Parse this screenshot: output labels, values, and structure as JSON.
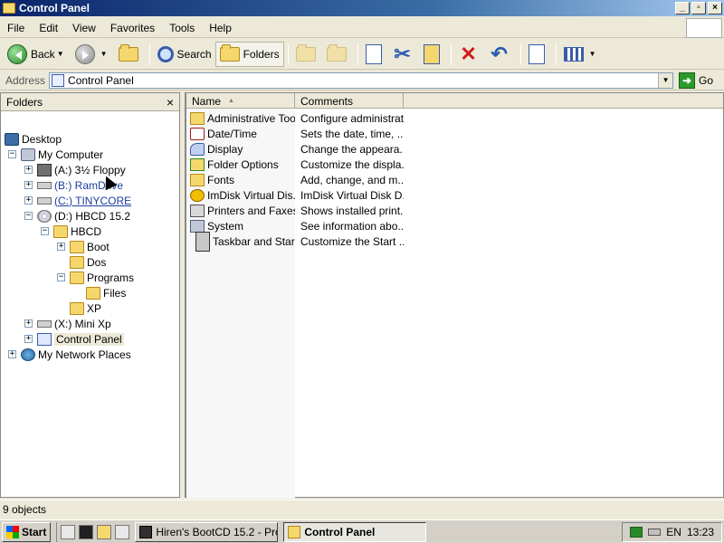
{
  "window": {
    "title": "Control Panel"
  },
  "menu": [
    "File",
    "Edit",
    "View",
    "Favorites",
    "Tools",
    "Help"
  ],
  "toolbar": {
    "back": "Back",
    "search": "Search",
    "folders": "Folders"
  },
  "address": {
    "label": "Address",
    "value": "Control Panel",
    "go": "Go"
  },
  "folders_pane": {
    "title": "Folders",
    "close": "×",
    "tree": [
      {
        "label": "Desktop",
        "level": 0,
        "expander": "",
        "icon": "desktop-icon"
      },
      {
        "label": "My Computer",
        "level": 1,
        "expander": "−",
        "icon": "computer-icon"
      },
      {
        "label": "(A:) 3½ Floppy",
        "level": 2,
        "expander": "+",
        "icon": "floppy-icon"
      },
      {
        "label": "(B:) RamDrive",
        "level": 2,
        "expander": "+",
        "icon": "drive-icon",
        "style": "link"
      },
      {
        "label": "(C:) TINYCORE",
        "level": 2,
        "expander": "+",
        "icon": "drive-icon",
        "style": "underline"
      },
      {
        "label": "(D:) HBCD 15.2",
        "level": 2,
        "expander": "−",
        "icon": "cd-icon"
      },
      {
        "label": "HBCD",
        "level": 3,
        "expander": "−",
        "icon": "folder-icon"
      },
      {
        "label": "Boot",
        "level": 4,
        "expander": "+",
        "icon": "folder-icon"
      },
      {
        "label": "Dos",
        "level": 4,
        "expander": "",
        "icon": "folder-icon"
      },
      {
        "label": "Programs",
        "level": 4,
        "expander": "−",
        "icon": "folder-icon"
      },
      {
        "label": "Files",
        "level": 5,
        "expander": "",
        "icon": "folder-icon"
      },
      {
        "label": "XP",
        "level": 4,
        "expander": "",
        "icon": "folder-icon"
      },
      {
        "label": "(X:) Mini Xp",
        "level": 2,
        "expander": "+",
        "icon": "drive-icon"
      },
      {
        "label": "Control Panel",
        "level": 2,
        "expander": "+",
        "icon": "control-panel-icon",
        "style": "selected"
      },
      {
        "label": "My Network Places",
        "level": 1,
        "expander": "+",
        "icon": "network-icon"
      }
    ]
  },
  "list": {
    "columns": {
      "name": "Name",
      "comments": "Comments"
    },
    "items": [
      {
        "name": "Administrative Tools",
        "comment": "Configure administrat...",
        "icon": "fold"
      },
      {
        "name": "Date/Time",
        "comment": "Sets the date, time, ...",
        "icon": "clock"
      },
      {
        "name": "Display",
        "comment": "Change the appeara...",
        "icon": "disp"
      },
      {
        "name": "Folder Options",
        "comment": "Customize the displa...",
        "icon": "fopt"
      },
      {
        "name": "Fonts",
        "comment": "Add, change, and m...",
        "icon": "font"
      },
      {
        "name": "ImDisk Virtual Dis...",
        "comment": "ImDisk Virtual Disk D...",
        "icon": "imd"
      },
      {
        "name": "Printers and Faxes",
        "comment": "Shows installed print...",
        "icon": "prn"
      },
      {
        "name": "System",
        "comment": "See information abo...",
        "icon": "sys"
      },
      {
        "name": "Taskbar and Start...",
        "comment": "Customize the Start ...",
        "icon": "task"
      }
    ]
  },
  "status": {
    "text": "9 objects"
  },
  "taskbar": {
    "start": "Start",
    "tasks": [
      "Hiren's BootCD 15.2 - Pro...",
      "Control Panel"
    ],
    "lang": "EN",
    "clock": "13:23"
  }
}
